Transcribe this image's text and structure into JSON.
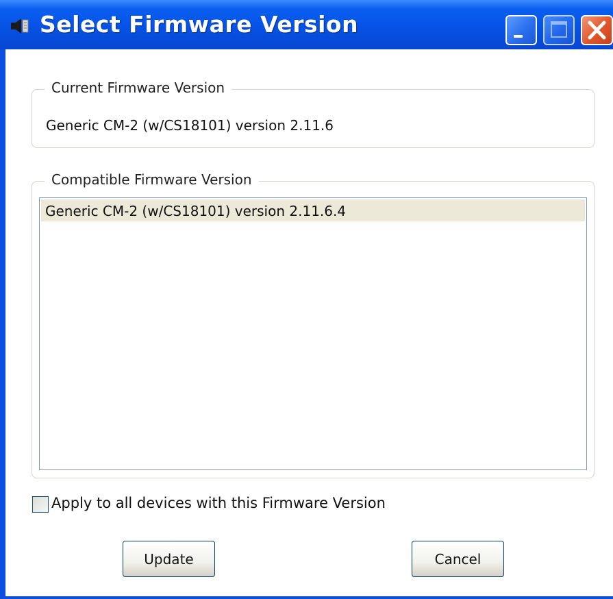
{
  "window": {
    "title": "Select Firmware Version",
    "icons": {
      "app": "speaker-icon",
      "minimize": "minimize-icon",
      "maximize": "maximize-icon",
      "close": "close-icon"
    }
  },
  "current_firmware": {
    "legend": "Current Firmware Version",
    "value": "Generic CM-2 (w/CS18101) version 2.11.6"
  },
  "compatible_firmware": {
    "legend": "Compatible Firmware Version",
    "items": [
      {
        "label": "Generic CM-2 (w/CS18101) version 2.11.6.4",
        "selected": true
      }
    ]
  },
  "apply_all": {
    "label": "Apply to all devices with this Firmware Version",
    "checked": false
  },
  "buttons": {
    "update": "Update",
    "cancel": "Cancel"
  },
  "colors": {
    "titlebar": "#0652e6",
    "close_button": "#e0562c",
    "selection": "#ece9d8",
    "listbox_border": "#7f9db9"
  }
}
